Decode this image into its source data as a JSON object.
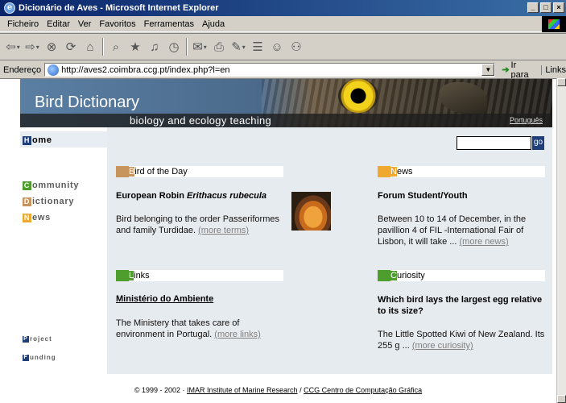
{
  "window": {
    "title": "Dicionário de Aves - Microsoft Internet Explorer"
  },
  "menu": [
    "Ficheiro",
    "Editar",
    "Ver",
    "Favoritos",
    "Ferramentas",
    "Ajuda"
  ],
  "address": {
    "label": "Endereço",
    "url": "http://aves2.coimbra.ccg.pt/index.php?l=en",
    "go_label": "Ir para",
    "links_label": "Links"
  },
  "banner": {
    "title": "Bird Dictionary",
    "subtitle": "biology and ecology teaching",
    "language": "Português"
  },
  "nav": {
    "home": {
      "cap": "H",
      "rest": "ome"
    },
    "community": {
      "cap": "C",
      "rest": "ommunity"
    },
    "dictionary": {
      "cap": "D",
      "rest": "ictionary"
    },
    "news": {
      "cap": "N",
      "rest": "ews"
    },
    "project": {
      "cap": "P",
      "rest": "roject"
    },
    "funding": {
      "cap": "F",
      "rest": "unding"
    }
  },
  "search": {
    "go": "go"
  },
  "sections": {
    "bird_of_day": {
      "cap": "B",
      "rest": "ird of the Day",
      "title": "European Robin",
      "latin": "Erithacus rubecula",
      "body": "Bird belonging to the order Passeriformes and family Turdidae.",
      "more": "(more terms)"
    },
    "news": {
      "cap": "N",
      "rest": "ews",
      "title": "Forum Student/Youth",
      "body": "Between 10 to 14 of December, in the pavillion 4 of FIL -International Fair of Lisbon, it will take ...",
      "more": "(more news)"
    },
    "links": {
      "cap": "L",
      "rest": "inks",
      "title": "Ministério do Ambiente",
      "body": "The Ministery that takes care of environment in Portugal.",
      "more": "(more links)"
    },
    "curiosity": {
      "cap": "C",
      "rest": "uriosity",
      "title": "Which bird lays the largest egg relative to its size?",
      "body": "The Little Spotted Kiwi of New Zealand. Its 255 g ...",
      "more": "(more curiosity)"
    }
  },
  "footer": {
    "prefix": "© 1999 - 2002 ·",
    "imar": "IMAR Institute of Marine Research",
    "sep": "/",
    "ccg": "CCG Centro de Computação Gráfica"
  },
  "colors": {
    "green": "#4e9e2d",
    "tan": "#c8945e",
    "orange": "#f0a930",
    "navy": "#1f3f7a"
  }
}
